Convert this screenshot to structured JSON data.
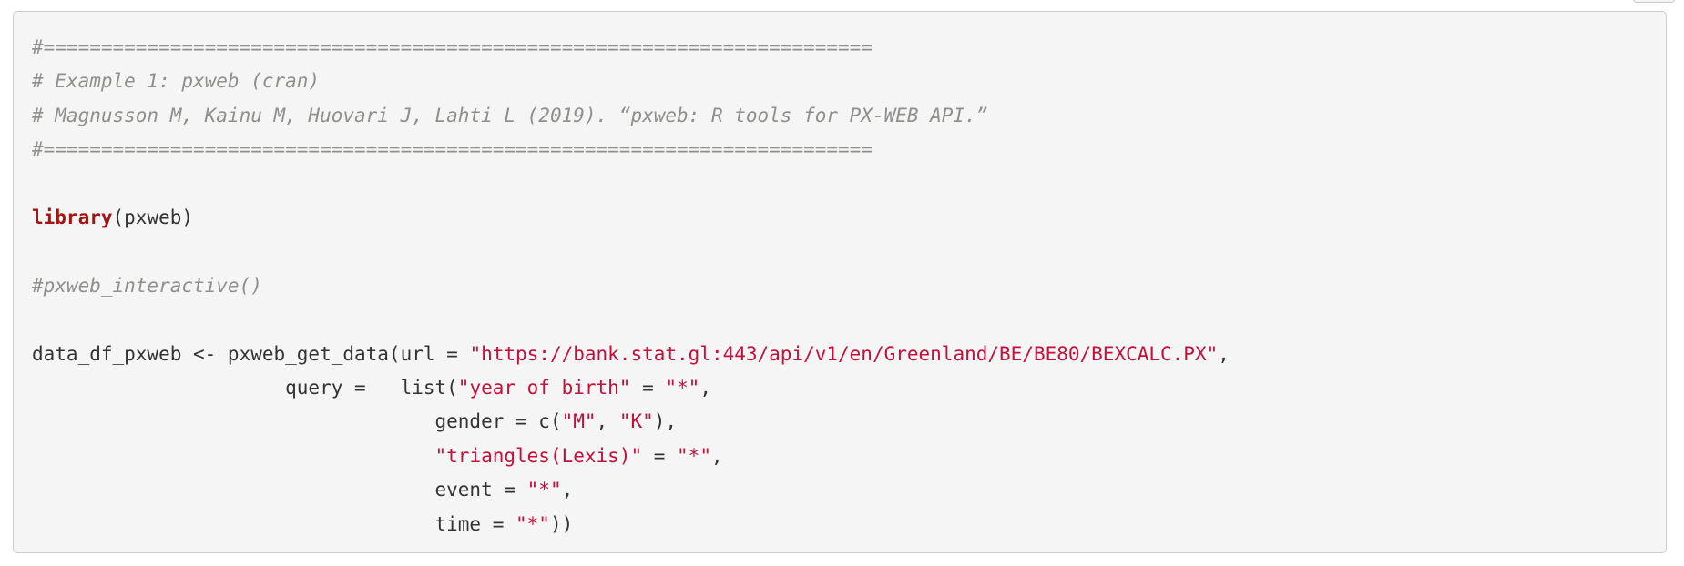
{
  "code": {
    "lines": [
      [
        {
          "t": "#========================================================================",
          "c": "cm"
        }
      ],
      [
        {
          "t": "# Example 1: pxweb (cran)",
          "c": "cm"
        }
      ],
      [
        {
          "t": "# Magnusson M, Kainu M, Huovari J, Lahti L (2019). “pxweb: R tools for PX-WEB API.”",
          "c": "cm"
        }
      ],
      [
        {
          "t": "#========================================================================",
          "c": "cm"
        }
      ],
      [],
      [
        {
          "t": "library",
          "c": "kw"
        },
        {
          "t": "(pxweb)",
          "c": ""
        }
      ],
      [],
      [
        {
          "t": "#pxweb_interactive()",
          "c": "cm"
        }
      ],
      [],
      [
        {
          "t": "data_df_pxweb <- pxweb_get_data(url = ",
          "c": ""
        },
        {
          "t": "\"https://bank.stat.gl:443/api/v1/en/Greenland/BE/BE80/BEXCALC.PX\"",
          "c": "st"
        },
        {
          "t": ",",
          "c": ""
        }
      ],
      [
        {
          "t": "                      query =   list(",
          "c": ""
        },
        {
          "t": "\"year of birth\"",
          "c": "st"
        },
        {
          "t": " = ",
          "c": ""
        },
        {
          "t": "\"*\"",
          "c": "st"
        },
        {
          "t": ",",
          "c": ""
        }
      ],
      [
        {
          "t": "                                   gender = c(",
          "c": ""
        },
        {
          "t": "\"M\"",
          "c": "st"
        },
        {
          "t": ", ",
          "c": ""
        },
        {
          "t": "\"K\"",
          "c": "st"
        },
        {
          "t": "),",
          "c": ""
        }
      ],
      [
        {
          "t": "                                   ",
          "c": ""
        },
        {
          "t": "\"triangles(Lexis)\"",
          "c": "st"
        },
        {
          "t": " = ",
          "c": ""
        },
        {
          "t": "\"*\"",
          "c": "st"
        },
        {
          "t": ",",
          "c": ""
        }
      ],
      [
        {
          "t": "                                   event = ",
          "c": ""
        },
        {
          "t": "\"*\"",
          "c": "st"
        },
        {
          "t": ",",
          "c": ""
        }
      ],
      [
        {
          "t": "                                   time = ",
          "c": ""
        },
        {
          "t": "\"*\"",
          "c": "st"
        },
        {
          "t": "))",
          "c": ""
        }
      ]
    ]
  }
}
